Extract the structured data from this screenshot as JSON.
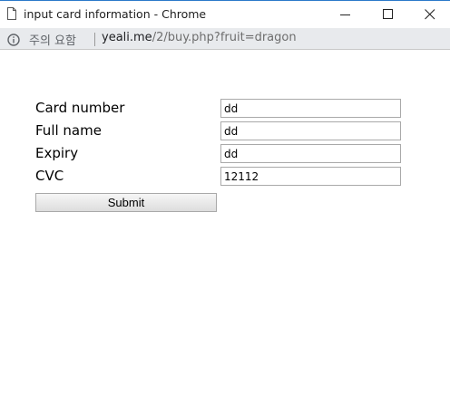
{
  "window": {
    "title": "input card information - Chrome",
    "page_icon": "page-icon",
    "controls": [
      "minimize-icon",
      "maximize-icon",
      "close-icon"
    ]
  },
  "addressbar": {
    "security_label": "주의 요함",
    "security_icon": "info-icon",
    "url_host": "yeali.me",
    "url_path": "/2/buy.php?fruit=dragon"
  },
  "form": {
    "fields": [
      {
        "label": "Card number",
        "value": "dd"
      },
      {
        "label": "Full name",
        "value": "dd"
      },
      {
        "label": "Expiry",
        "value": "dd"
      },
      {
        "label": "CVC",
        "value": "12112"
      }
    ],
    "submit_label": "Submit"
  }
}
